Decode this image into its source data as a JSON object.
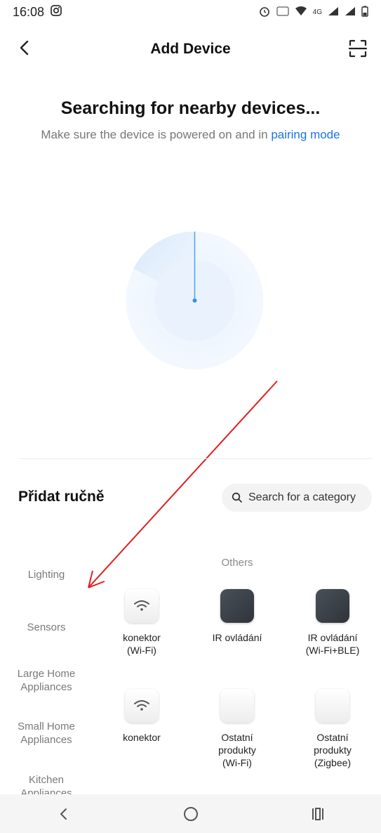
{
  "status_bar": {
    "time": "16:08",
    "network": "4G"
  },
  "header": {
    "title": "Add Device"
  },
  "search": {
    "title": "Searching for nearby devices...",
    "subtitle_prefix": "Make sure the device is powered on and in ",
    "subtitle_link": "pairing mode"
  },
  "manual": {
    "title": "Přidat ručně",
    "search_placeholder": "Search for a category"
  },
  "sidebar": {
    "items": [
      {
        "label": "Lighting"
      },
      {
        "label": "Sensors"
      },
      {
        "label": "Large Home Appliances"
      },
      {
        "label": "Small Home Appliances"
      },
      {
        "label": "Kitchen Appliances"
      }
    ]
  },
  "section": {
    "title": "Others"
  },
  "devices": [
    {
      "label": "konektor\n(Wi-Fi)",
      "icon": "wifi-icon",
      "style": "light"
    },
    {
      "label": "IR ovládání",
      "icon": "remote-icon",
      "style": "dark"
    },
    {
      "label": "IR ovládání\n(Wi-Fi+BLE)",
      "icon": "remote-icon",
      "style": "dark"
    },
    {
      "label": "konektor",
      "icon": "wifi-icon",
      "style": "light"
    },
    {
      "label": "Ostatní\nprodukty\n(Wi-Fi)",
      "icon": "blank-icon",
      "style": "light"
    },
    {
      "label": "Ostatní\nprodukty\n(Zigbee)",
      "icon": "blank-icon",
      "style": "light"
    }
  ],
  "colors": {
    "accent": "#1a73e8",
    "annotation_arrow": "#e02020"
  }
}
